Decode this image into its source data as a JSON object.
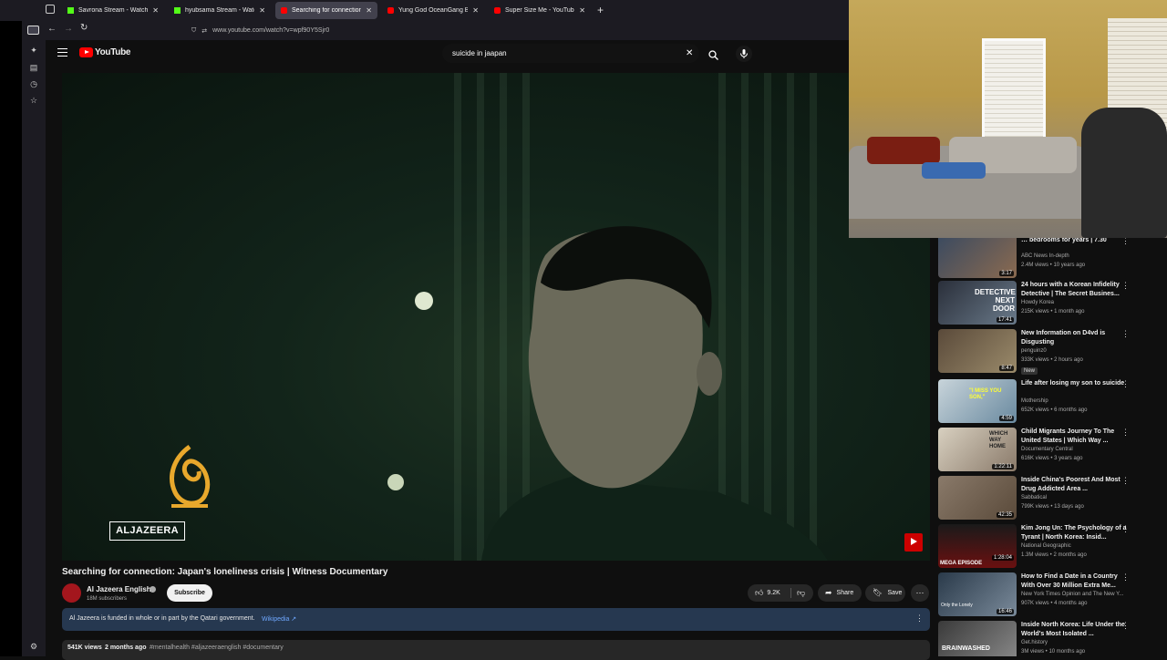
{
  "browser": {
    "tabs": [
      {
        "title": "Savrona Stream - Watch Live o",
        "active": false
      },
      {
        "title": "hyubsama Stream - Watch Live",
        "active": false
      },
      {
        "title": "Searching for connection: J",
        "active": true
      },
      {
        "title": "Yung God OceanGang Based F",
        "active": false
      },
      {
        "title": "Super Size Me - YouTube",
        "active": false
      }
    ],
    "new_tab": "+",
    "url": "www.youtube.com/watch?v=wpf90Y5Sjr0"
  },
  "youtube": {
    "logo_text": "YouTube",
    "search_value": "suicide in jaapan",
    "clear": "✕",
    "player": {
      "watermark": "ALJAZEERA"
    },
    "video_title": "Searching for connection: Japan's loneliness crisis | Witness Documentary",
    "channel": {
      "name": "Al Jazeera English",
      "subscribers": "18M subscribers",
      "subscribe_label": "Subscribe"
    },
    "actions": {
      "likes": "9.2K",
      "share": "Share",
      "save": "Save"
    },
    "notice": {
      "text": "Al Jazeera is funded in whole or in part by the Qatari government.",
      "link": "Wikipedia ↗"
    },
    "description": {
      "views": "541K views",
      "age": "2 months ago",
      "tags": "#mentalhealth #aljazeeraenglish #documentary"
    },
    "recommendations": [
      {
        "title": "… bedrooms for years | 7.30",
        "channel": "ABC News In-depth",
        "meta": "2.4M views • 10 years ago",
        "duration": "3:17",
        "badge": ""
      },
      {
        "title": "24 hours with a Korean Infidelity Detective | The Secret Busines...",
        "channel": "Howdy Korea",
        "meta": "215K views • 1 month ago",
        "duration": "17:41",
        "badge": ""
      },
      {
        "title": "New Information on D4vd is Disgusting",
        "channel": "penguinz0",
        "meta": "333K views • 2 hours ago",
        "duration": "8:47",
        "badge": "New"
      },
      {
        "title": "Life after losing my son to suicide",
        "channel": "Mothership",
        "meta": "652K views • 6 months ago",
        "duration": "4:59",
        "badge": ""
      },
      {
        "title": "Child Migrants Journey To The United States | Which Way ...",
        "channel": "Documentary Central",
        "meta": "616K views • 3 years ago",
        "duration": "1:22:11",
        "badge": ""
      },
      {
        "title": "Inside China's Poorest And Most Drug Addicted Area ...",
        "channel": "Sabbatical",
        "meta": "799K views • 13 days ago",
        "duration": "42:35",
        "badge": ""
      },
      {
        "title": "Kim Jong Un: The Psychology of a Tyrant | North Korea: Insid...",
        "channel": "National Geographic",
        "meta": "1.3M views • 2 months ago",
        "duration": "1:28:04",
        "badge": ""
      },
      {
        "title": "How to Find a Date in a Country With Over 30 Million Extra Me...",
        "channel": "New York Times Opinion and The New Y...",
        "meta": "907K views • 4 months ago",
        "duration": "16:46",
        "badge": ""
      },
      {
        "title": "Inside North Korea: Life Under the World's Most Isolated ...",
        "channel": "Get.history",
        "meta": "3M views • 10 months ago",
        "duration": "",
        "badge": ""
      }
    ],
    "thumb_texts": {
      "detective": "DETECTIVE NEXT DOOR",
      "miss_you": "\"I MISS YOU SON,\"",
      "which_way": "WHICH WAY HOME",
      "mega": "MEGA EPISODE",
      "only_lonely": "Only the Lonely",
      "brainwashed": "BRAINWASHED"
    },
    "colors": {
      "accent": "#ff0000",
      "bg": "#0f0f0f"
    }
  }
}
